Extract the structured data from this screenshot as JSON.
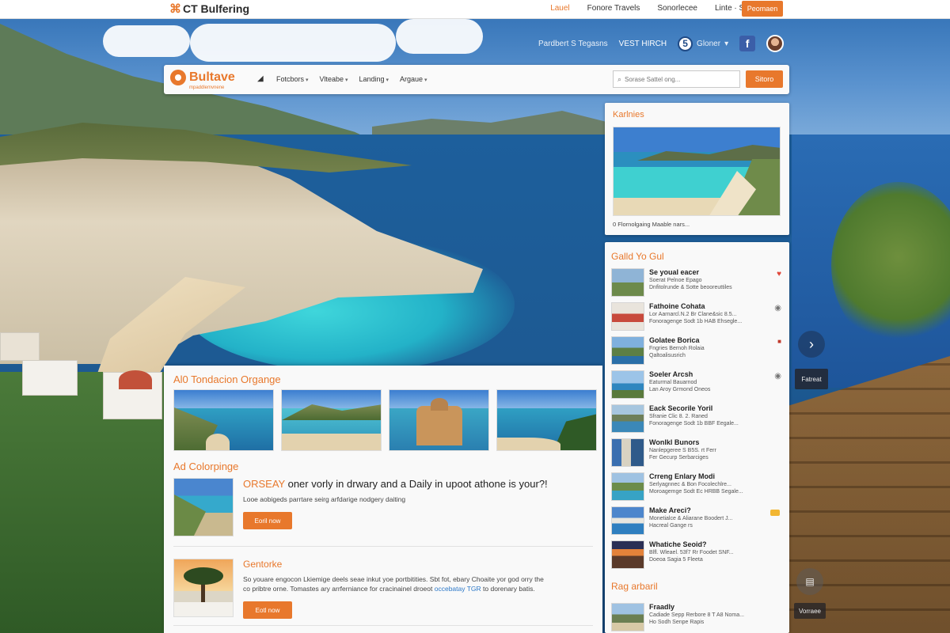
{
  "site": {
    "brand": "CT Bulfering",
    "brand_mark": "⌘",
    "nav": [
      "Lauel",
      "Fonore Travels",
      "Sonorlecee",
      "Linte · Smolaleking"
    ],
    "cta": "Peomaen"
  },
  "overlay": {
    "link1": "Pardbert S Tegasns",
    "link2": "VEST HIRCH",
    "lang_code": "5",
    "lang_label": "Gloner",
    "fb_letter": "f"
  },
  "header": {
    "logo_name": "Bultave",
    "logo_tagline": "mpaddlemvnene",
    "menu_icon": "bullhorn-icon",
    "menu": [
      "Fotcbors",
      "Vlteabe",
      "Landing",
      "Argaue"
    ],
    "search_placeholder": "Sorase Sattel ong...",
    "search_button": "Sitoro"
  },
  "content": {
    "section1_title": "Al0 Tondacion Organge",
    "section2_title": "Ad Colorpinge",
    "feature1": {
      "headline_hl": "ORSEAY",
      "headline_rest": " oner vorly in drwary and a Daily in upoot athone is your?!",
      "desc": "Looe aobigeds parrtare seirg arfdarige nodgery daiting",
      "button": "Eoril now"
    },
    "feature2": {
      "title": "Gentorke",
      "desc_a": "So youare engocon Lkiemige deels seae inkut yoe portbitities. Sbt fot, ebary Choaite yor god orry the",
      "desc_b": "co pribtre orne. Tomastes ary arrferniance for cracinainel droeot ",
      "desc_link": "occebatay TGR",
      "desc_c": " to dorenary batis.",
      "button": "Eotl now"
    }
  },
  "sidebar": {
    "box1_title": "Karlnies",
    "box1_caption": "0 Flornolgaing Maable nars...",
    "box2_title": "Galld Yo Gul",
    "items": [
      {
        "title": "Se youal eacer",
        "l1": "Soerat Pelnoe Epago",
        "l2": "Dnfitolrunde & Sotte beooreuttiles",
        "icon": "heart-icon"
      },
      {
        "title": "Fathoine Cohata",
        "l1": "Lor Aarnarcl.N.2 Br Clane&sic 8.5...",
        "l2": "Fonoragenge Sodt 1b HAB Ehsegle...",
        "icon": "info-icon"
      },
      {
        "title": "Golatee Borica",
        "l1": "Fngries Bernoh Rolaia",
        "l2": "Qaltoalisusrich",
        "icon": "flag-icon"
      },
      {
        "title": "Soeler Arcsh",
        "l1": "Eaturmal Bauarnod",
        "l2": "Lan Aroy Grmond Oneos",
        "icon": "info-icon"
      },
      {
        "title": "Eack Secorile Yoril",
        "l1": "Sfranie Clic 8. 2. Raned",
        "l2": "Fonoragenge Sodt 1b BBF Eegale...",
        "icon": ""
      },
      {
        "title": "Wonlkl Bunors",
        "l1": "Nanlepgeree S B5S. rt Ferr",
        "l2": "Fer Gecurp Serbarciges",
        "icon": ""
      },
      {
        "title": "Crreng Enlary Modi",
        "l1": "Serlyagnnec & Bon Focolechlre...",
        "l2": "Moroagemge Sodt Ec HRBB Segale...",
        "icon": ""
      },
      {
        "title": "Make Areci?",
        "l1": "Monetialce & Aliarane Boodert J...",
        "l2": "Hacreal Gange rs",
        "icon": "tag-icon"
      },
      {
        "title": "Whatiche Seoid?",
        "l1": "Blfl. Wleael. 53f7 Rr Foodet SNF...",
        "l2": "Doeoa Sagia 5 Fleeta",
        "icon": ""
      }
    ],
    "sub_title": "Rag arbaril",
    "sub_items": [
      {
        "title": "Fraadly",
        "l1": "Cadiade Sepp Rerbore 8 T A8 Noma...",
        "l2": "Ho Sodh Senpe Rapis"
      }
    ]
  },
  "controls": {
    "next_glyph": "›",
    "tip_label": "Fatreat",
    "soft_icon": "printer-icon",
    "soft_glyph": "▤",
    "soft_label": "Vorraee"
  },
  "colors": {
    "accent": "#e8782c",
    "link": "#2c78c8"
  }
}
